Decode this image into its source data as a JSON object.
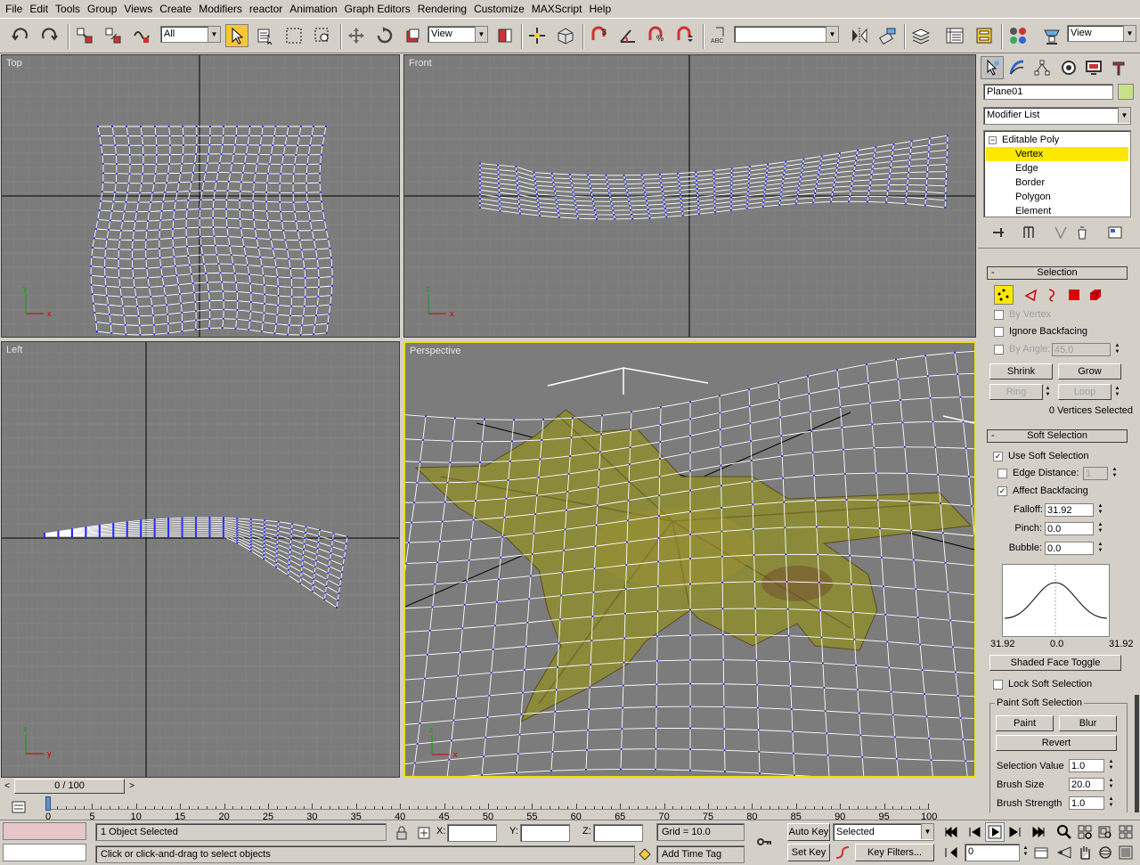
{
  "menu": [
    "File",
    "Edit",
    "Tools",
    "Group",
    "Views",
    "Create",
    "Modifiers",
    "reactor",
    "Animation",
    "Graph Editors",
    "Rendering",
    "Customize",
    "MAXScript",
    "Help"
  ],
  "toolbar": {
    "selection_filter": "All",
    "ref_coord": "View",
    "named_selection": "",
    "render_view": "View"
  },
  "viewports": {
    "top": {
      "label": "Top"
    },
    "front": {
      "label": "Front"
    },
    "left": {
      "label": "Left"
    },
    "perspective": {
      "label": "Perspective"
    }
  },
  "command_panel": {
    "object_name": "Plane01",
    "object_color": "#c8e08c",
    "modifier_list": "Modifier List",
    "stack": {
      "root": "Editable Poly",
      "items": [
        "Vertex",
        "Edge",
        "Border",
        "Polygon",
        "Element"
      ],
      "selected": "Vertex"
    },
    "selection": {
      "title": "Selection",
      "by_vertex": "By Vertex",
      "ignore_backfacing": "Ignore Backfacing",
      "by_angle": "By Angle:",
      "by_angle_value": "45.0",
      "shrink": "Shrink",
      "grow": "Grow",
      "ring": "Ring",
      "loop": "Loop",
      "status": "0 Vertices Selected"
    },
    "soft_selection": {
      "title": "Soft Selection",
      "use_soft_selection": "Use Soft Selection",
      "edge_distance": "Edge Distance:",
      "edge_distance_value": "1",
      "affect_backfacing": "Affect Backfacing",
      "falloff_label": "Falloff:",
      "falloff": "31.92",
      "pinch_label": "Pinch:",
      "pinch": "0.0",
      "bubble_label": "Bubble:",
      "bubble": "0.0",
      "curve_left": "31.92",
      "curve_mid": "0.0",
      "curve_right": "31.92",
      "shaded_face_toggle": "Shaded Face Toggle",
      "lock_soft_selection": "Lock Soft Selection",
      "paint_group": "Paint Soft Selection",
      "paint": "Paint",
      "blur": "Blur",
      "revert": "Revert",
      "selection_value_label": "Selection Value",
      "selection_value": "1.0",
      "brush_size_label": "Brush Size",
      "brush_size": "20.0",
      "brush_strength_label": "Brush Strength",
      "brush_strength": "1.0"
    }
  },
  "timeline": {
    "slider_text": "0 / 100",
    "ticks": [
      "0",
      "5",
      "10",
      "15",
      "20",
      "25",
      "30",
      "35",
      "40",
      "45",
      "50",
      "55",
      "60",
      "65",
      "70",
      "75",
      "80",
      "85",
      "90",
      "95",
      "100"
    ]
  },
  "status": {
    "selection": "1 Object Selected",
    "prompt": "Click or click-and-drag to select objects",
    "x_label": "X:",
    "y_label": "Y:",
    "z_label": "Z:",
    "grid": "Grid = 10.0",
    "add_time_tag": "Add Time Tag",
    "auto_key": "Auto Key",
    "set_key": "Set Key",
    "key_mode": "Selected",
    "key_filters": "Key Filters...",
    "frame": "0"
  }
}
